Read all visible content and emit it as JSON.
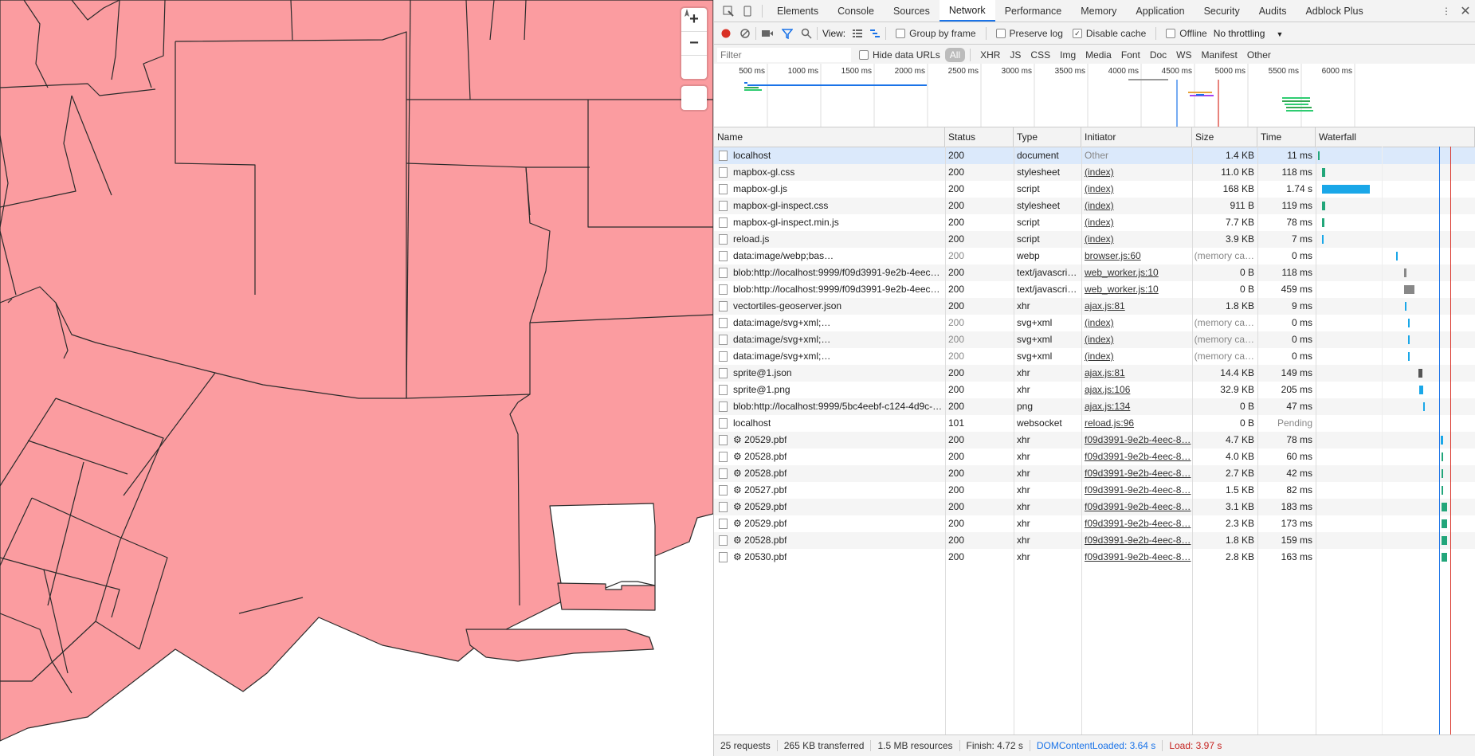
{
  "map": {
    "zoom_in_label": "+",
    "zoom_out_label": "−",
    "colors": {
      "fill": "#fb9ca0",
      "stroke": "#2a2a2a",
      "background": "#ffffff"
    }
  },
  "devtools": {
    "tabs": [
      "Elements",
      "Console",
      "Sources",
      "Network",
      "Performance",
      "Memory",
      "Application",
      "Security",
      "Audits",
      "Adblock Plus"
    ],
    "active_tab": "Network",
    "toolbar": {
      "view_label": "View:",
      "group_by_frame": "Group by frame",
      "preserve_log": "Preserve log",
      "disable_cache": "Disable cache",
      "offline": "Offline",
      "throttling": "No throttling"
    },
    "filter": {
      "placeholder": "Filter",
      "hide_data_urls": "Hide data URLs",
      "types": [
        "All",
        "XHR",
        "JS",
        "CSS",
        "Img",
        "Media",
        "Font",
        "Doc",
        "WS",
        "Manifest",
        "Other"
      ]
    },
    "overview_ticks": [
      "500 ms",
      "1000 ms",
      "1500 ms",
      "2000 ms",
      "2500 ms",
      "3000 ms",
      "3500 ms",
      "4000 ms",
      "4500 ms",
      "5000 ms",
      "5500 ms",
      "6000 ms"
    ],
    "columns": [
      "Name",
      "Status",
      "Type",
      "Initiator",
      "Size",
      "Time",
      "Waterfall"
    ],
    "rows": [
      {
        "name": "localhost",
        "status": "200",
        "type": "document",
        "initiator": "Other",
        "size": "1.4 KB",
        "time": "11 ms"
      },
      {
        "name": "mapbox-gl.css",
        "status": "200",
        "type": "stylesheet",
        "initiator": "(index)",
        "size": "11.0 KB",
        "time": "118 ms"
      },
      {
        "name": "mapbox-gl.js",
        "status": "200",
        "type": "script",
        "initiator": "(index)",
        "size": "168 KB",
        "time": "1.74 s"
      },
      {
        "name": "mapbox-gl-inspect.css",
        "status": "200",
        "type": "stylesheet",
        "initiator": "(index)",
        "size": "911 B",
        "time": "119 ms"
      },
      {
        "name": "mapbox-gl-inspect.min.js",
        "status": "200",
        "type": "script",
        "initiator": "(index)",
        "size": "7.7 KB",
        "time": "78 ms"
      },
      {
        "name": "reload.js",
        "status": "200",
        "type": "script",
        "initiator": "(index)",
        "size": "3.9 KB",
        "time": "7 ms"
      },
      {
        "name": "data:image/webp;bas…",
        "status": "200",
        "type": "webp",
        "initiator": "browser.js:60",
        "size": "(memory ca…",
        "time": "0 ms"
      },
      {
        "name": "blob:http://localhost:9999/f09d3991-9e2b-4eec…",
        "status": "200",
        "type": "text/javascri…",
        "initiator": "web_worker.js:10",
        "size": "0 B",
        "time": "118 ms"
      },
      {
        "name": "blob:http://localhost:9999/f09d3991-9e2b-4eec…",
        "status": "200",
        "type": "text/javascri…",
        "initiator": "web_worker.js:10",
        "size": "0 B",
        "time": "459 ms"
      },
      {
        "name": "vectortiles-geoserver.json",
        "status": "200",
        "type": "xhr",
        "initiator": "ajax.js:81",
        "size": "1.8 KB",
        "time": "9 ms"
      },
      {
        "name": "data:image/svg+xml;…",
        "status": "200",
        "type": "svg+xml",
        "initiator": "(index)",
        "size": "(memory ca…",
        "time": "0 ms"
      },
      {
        "name": "data:image/svg+xml;…",
        "status": "200",
        "type": "svg+xml",
        "initiator": "(index)",
        "size": "(memory ca…",
        "time": "0 ms"
      },
      {
        "name": "data:image/svg+xml;…",
        "status": "200",
        "type": "svg+xml",
        "initiator": "(index)",
        "size": "(memory ca…",
        "time": "0 ms"
      },
      {
        "name": "sprite@1.json",
        "status": "200",
        "type": "xhr",
        "initiator": "ajax.js:81",
        "size": "14.4 KB",
        "time": "149 ms"
      },
      {
        "name": "sprite@1.png",
        "status": "200",
        "type": "xhr",
        "initiator": "ajax.js:106",
        "size": "32.9 KB",
        "time": "205 ms"
      },
      {
        "name": "blob:http://localhost:9999/5bc4eebf-c124-4d9c-…",
        "status": "200",
        "type": "png",
        "initiator": "ajax.js:134",
        "size": "0 B",
        "time": "47 ms"
      },
      {
        "name": "localhost",
        "status": "101",
        "type": "websocket",
        "initiator": "reload.js:96",
        "size": "0 B",
        "time": "Pending"
      },
      {
        "name": "⚙ 20529.pbf",
        "status": "200",
        "type": "xhr",
        "initiator": "f09d3991-9e2b-4eec-8…",
        "size": "4.7 KB",
        "time": "78 ms"
      },
      {
        "name": "⚙ 20528.pbf",
        "status": "200",
        "type": "xhr",
        "initiator": "f09d3991-9e2b-4eec-8…",
        "size": "4.0 KB",
        "time": "60 ms"
      },
      {
        "name": "⚙ 20528.pbf",
        "status": "200",
        "type": "xhr",
        "initiator": "f09d3991-9e2b-4eec-8…",
        "size": "2.7 KB",
        "time": "42 ms"
      },
      {
        "name": "⚙ 20527.pbf",
        "status": "200",
        "type": "xhr",
        "initiator": "f09d3991-9e2b-4eec-8…",
        "size": "1.5 KB",
        "time": "82 ms"
      },
      {
        "name": "⚙ 20529.pbf",
        "status": "200",
        "type": "xhr",
        "initiator": "f09d3991-9e2b-4eec-8…",
        "size": "3.1 KB",
        "time": "183 ms"
      },
      {
        "name": "⚙ 20529.pbf",
        "status": "200",
        "type": "xhr",
        "initiator": "f09d3991-9e2b-4eec-8…",
        "size": "2.3 KB",
        "time": "173 ms"
      },
      {
        "name": "⚙ 20528.pbf",
        "status": "200",
        "type": "xhr",
        "initiator": "f09d3991-9e2b-4eec-8…",
        "size": "1.8 KB",
        "time": "159 ms"
      },
      {
        "name": "⚙ 20530.pbf",
        "status": "200",
        "type": "xhr",
        "initiator": "f09d3991-9e2b-4eec-8…",
        "size": "2.8 KB",
        "time": "163 ms"
      }
    ],
    "status_bar": {
      "requests": "25 requests",
      "transferred": "265 KB transferred",
      "resources": "1.5 MB resources",
      "finish": "Finish: 4.72 s",
      "dom_content_loaded": "DOMContentLoaded: 3.64 s",
      "load": "Load: 3.97 s"
    }
  }
}
